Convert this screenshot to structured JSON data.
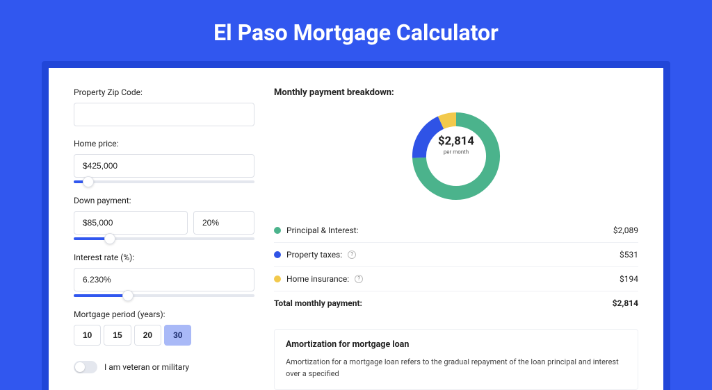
{
  "title": "El Paso Mortgage Calculator",
  "form": {
    "zip_label": "Property Zip Code:",
    "zip_value": "",
    "home_price_label": "Home price:",
    "home_price_value": "$425,000",
    "home_price_slider_pct": 8,
    "down_label": "Down payment:",
    "down_value": "$85,000",
    "down_pct_value": "20%",
    "down_slider_pct": 20,
    "rate_label": "Interest rate (%):",
    "rate_value": "6.230%",
    "rate_slider_pct": 30,
    "period_label": "Mortgage period (years):",
    "period_options": [
      "10",
      "15",
      "20",
      "30"
    ],
    "period_selected": "30",
    "vet_label": "I am veteran or military",
    "vet_on": false
  },
  "breakdown": {
    "title": "Monthly payment breakdown:",
    "center_value": "$2,814",
    "center_sub": "per month",
    "items": [
      {
        "label": "Principal & Interest:",
        "value": "$2,089",
        "color": "#4bb38c",
        "has_info": false
      },
      {
        "label": "Property taxes:",
        "value": "$531",
        "color": "#2f53e6",
        "has_info": true
      },
      {
        "label": "Home insurance:",
        "value": "$194",
        "color": "#f2c94c",
        "has_info": true
      }
    ],
    "total_label": "Total monthly payment:",
    "total_value": "$2,814"
  },
  "chart_data": {
    "type": "pie",
    "title": "Monthly payment breakdown",
    "series": [
      {
        "name": "Principal & Interest",
        "value": 2089,
        "color": "#4bb38c"
      },
      {
        "name": "Property taxes",
        "value": 531,
        "color": "#2f53e6"
      },
      {
        "name": "Home insurance",
        "value": 194,
        "color": "#f2c94c"
      }
    ],
    "center_label": "$2,814 per month"
  },
  "amort": {
    "title": "Amortization for mortgage loan",
    "text": "Amortization for a mortgage loan refers to the gradual repayment of the loan principal and interest over a specified"
  }
}
